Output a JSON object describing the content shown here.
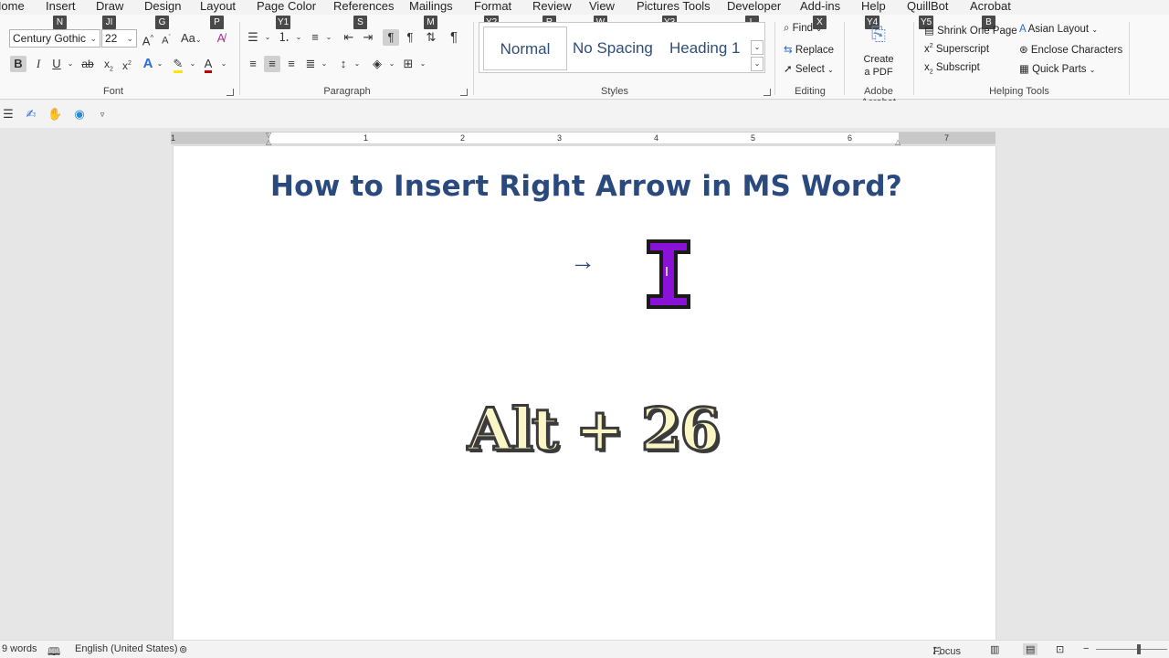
{
  "tabs": [
    {
      "label": "Home",
      "key": ""
    },
    {
      "label": "Insert",
      "key": "N"
    },
    {
      "label": "Draw",
      "key": "JI"
    },
    {
      "label": "Design",
      "key": "G"
    },
    {
      "label": "Layout",
      "key": "P"
    },
    {
      "label": "Page Color",
      "key": "Y1"
    },
    {
      "label": "References",
      "key": "S"
    },
    {
      "label": "Mailings",
      "key": "M"
    },
    {
      "label": "Format",
      "key": "Y2"
    },
    {
      "label": "Review",
      "key": "R"
    },
    {
      "label": "View",
      "key": "W"
    },
    {
      "label": "Pictures Tools",
      "key": "Y3"
    },
    {
      "label": "Developer",
      "key": "L"
    },
    {
      "label": "Add-ins",
      "key": "X"
    },
    {
      "label": "Help",
      "key": "Y4"
    },
    {
      "label": "QuillBot",
      "key": "Y5"
    },
    {
      "label": "Acrobat",
      "key": "B"
    }
  ],
  "font": {
    "family": "Century Gothic",
    "size": "22",
    "group_label": "Font"
  },
  "paragraph": {
    "group_label": "Paragraph"
  },
  "styles": {
    "items": [
      "Normal",
      "No Spacing",
      "Heading 1"
    ],
    "group_label": "Styles"
  },
  "editing": {
    "find": "Find",
    "replace": "Replace",
    "select": "Select",
    "group_label": "Editing"
  },
  "acrobat": {
    "create_line1": "Create",
    "create_line2": "a PDF",
    "group_label": "Adobe Acrobat"
  },
  "helping": {
    "shrink": "Shrink One Page",
    "superscript": "Superscript",
    "subscript": "Subscript",
    "asian": "Asian Layout",
    "enclose": "Enclose Characters",
    "quickparts": "Quick Parts",
    "group_label": "Helping Tools"
  },
  "ruler": {
    "numbers": [
      "1",
      "1",
      "2",
      "3",
      "4",
      "5",
      "6",
      "7"
    ]
  },
  "document": {
    "title": "How to Insert Right Arrow in MS Word?",
    "arrow": "→",
    "shortcut": "Alt + 26"
  },
  "status": {
    "words": "9 words",
    "language": "English (United States)",
    "focus": "Focus"
  },
  "colors": {
    "title": "#2a4a7e",
    "cursor": "#8a12d8",
    "shortcut_fill": "#fbf6c6"
  }
}
